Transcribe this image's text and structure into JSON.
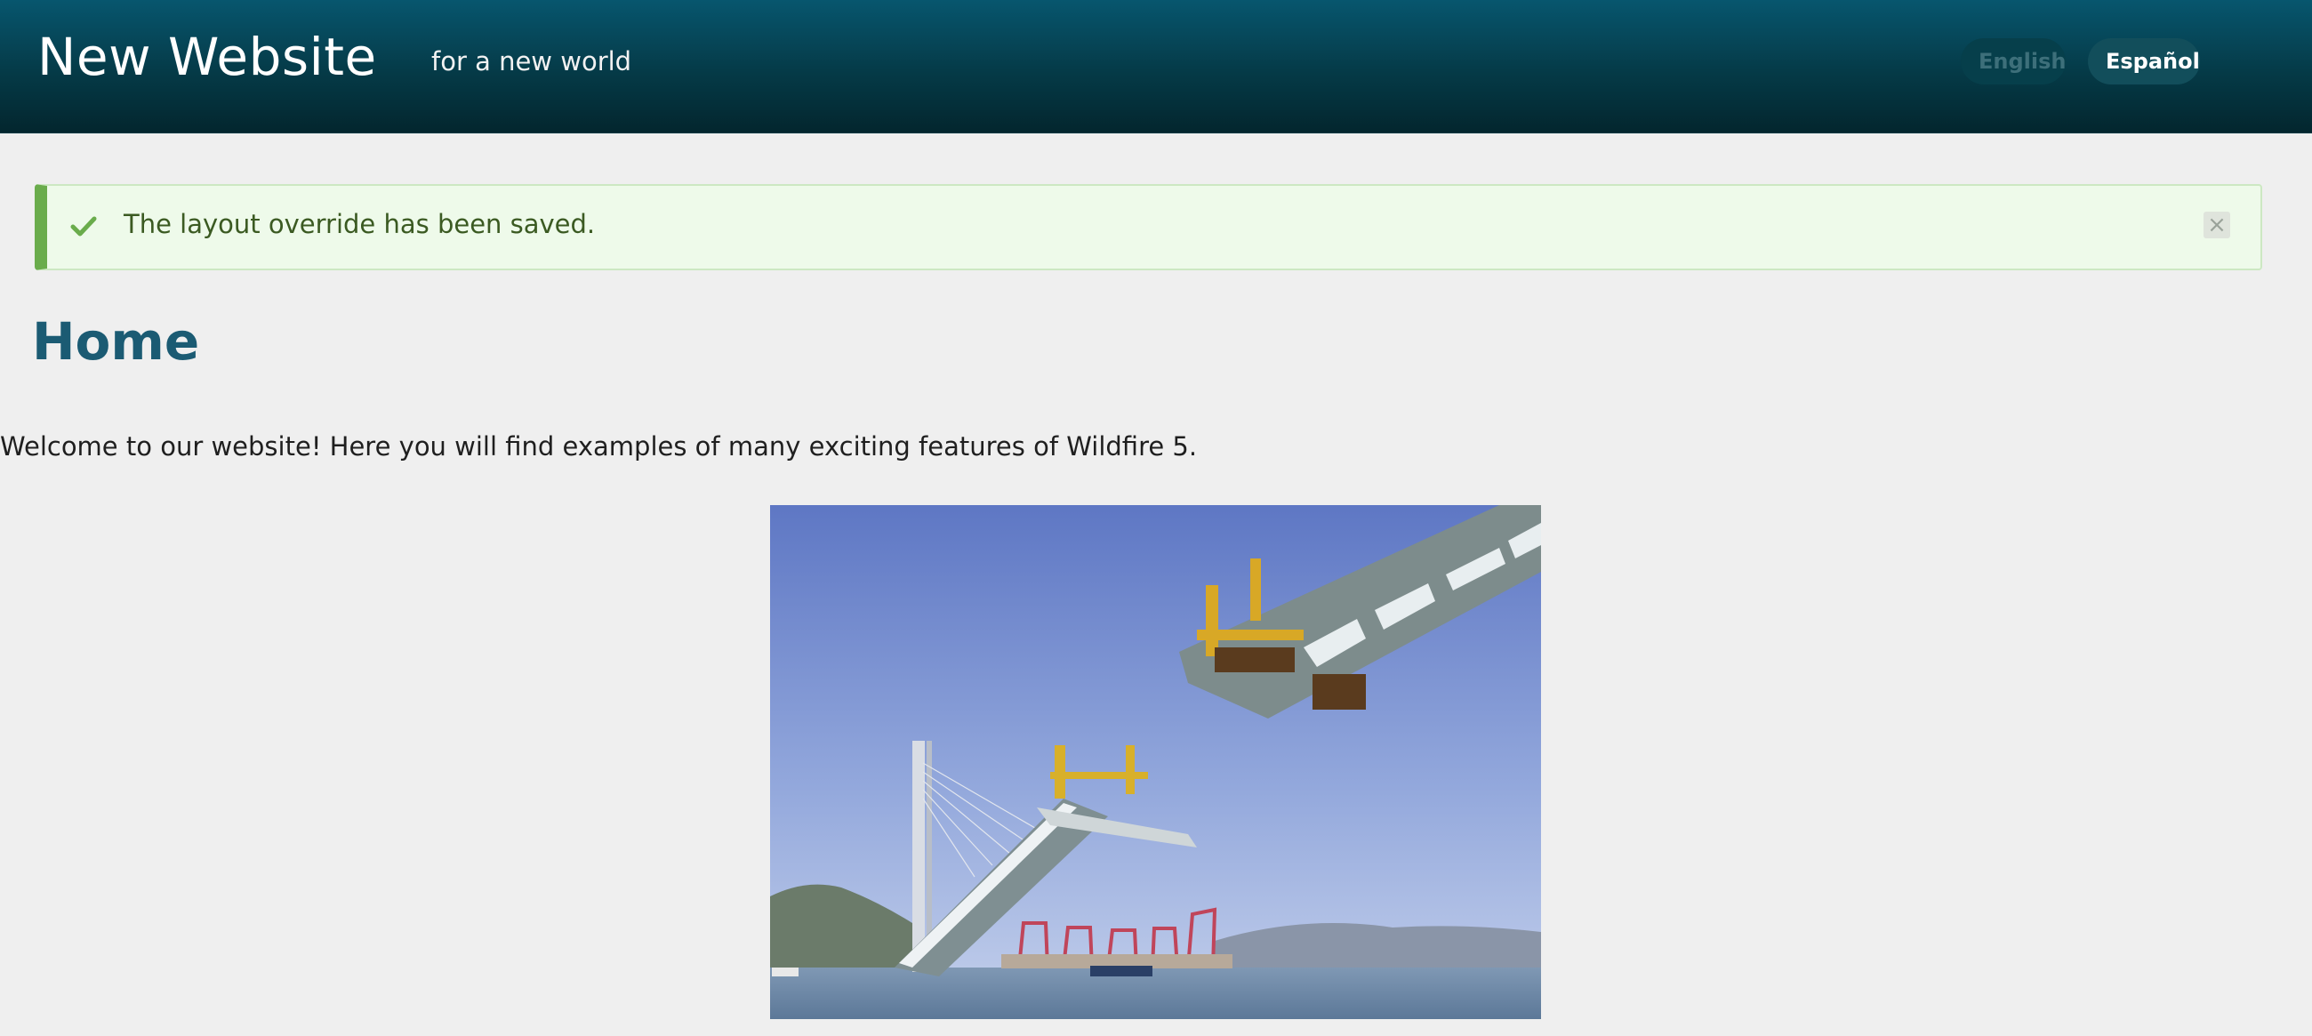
{
  "header": {
    "site_title": "New Website",
    "slogan": "for a new world",
    "languages": [
      {
        "label": "English",
        "active": false
      },
      {
        "label": "Español",
        "active": true
      }
    ]
  },
  "alert": {
    "message": "The layout override has been saved.",
    "close_symbol": "×",
    "icons": {
      "status": "check-icon",
      "close": "close-icon"
    }
  },
  "main": {
    "page_title": "Home",
    "intro": "Welcome to our website! Here you will find examples of many exciting features of Wildfire 5."
  },
  "colors": {
    "header_top": "#07566e",
    "header_bottom": "#03262e",
    "page_bg": "#efefef",
    "title": "#1b5b73",
    "success_accent": "#6aac4c",
    "success_bg": "#eefaea"
  }
}
